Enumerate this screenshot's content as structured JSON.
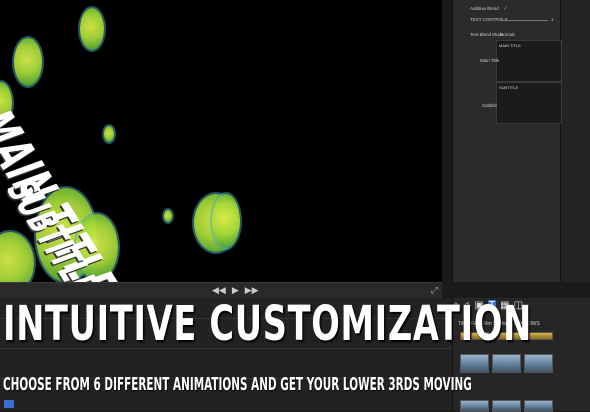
{
  "viewer": {
    "main_title": "MAIN TITLE",
    "subtitle": "SUBTITLE",
    "transport": [
      "◀◀",
      "▶",
      "▶▶"
    ]
  },
  "inspector": {
    "additive_blend": "Additive Blend",
    "text_controls": "TEXT CONTROLS",
    "text_blend_mode_label": "Text Blend Mode",
    "text_blend_mode_value": "Normal",
    "main_title_label": "Main Title",
    "main_title_value": "MAIN TITLE",
    "subtitle_label": "Subtitle",
    "subtitle_value": "SUBTITLE",
    "slider_value": "1"
  },
  "browser": {
    "tabs": "Titles   Fast Film Studios - PROLOWS"
  },
  "promo": {
    "headline": "INTUITIVE CUSTOMIZATION",
    "tagline": "CHOOSE FROM 6 DIFFERENT ANIMATIONS AND GET YOUR LOWER 3RDS MOVING"
  },
  "colors": {
    "accent": "#3b6fd1",
    "bubble": "#b5de3e"
  }
}
